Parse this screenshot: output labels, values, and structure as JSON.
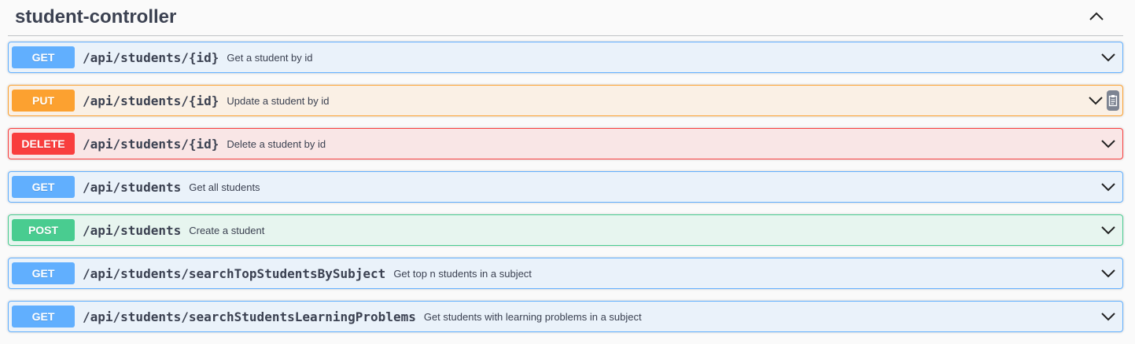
{
  "tag": {
    "title": "student-controller"
  },
  "operations": [
    {
      "method": "GET",
      "path": "/api/students/{id}",
      "summary": "Get a student by id"
    },
    {
      "method": "PUT",
      "path": "/api/students/{id}",
      "summary": "Update a student by id"
    },
    {
      "method": "DELETE",
      "path": "/api/students/{id}",
      "summary": "Delete a student by id"
    },
    {
      "method": "GET",
      "path": "/api/students",
      "summary": "Get all students"
    },
    {
      "method": "POST",
      "path": "/api/students",
      "summary": "Create a student"
    },
    {
      "method": "GET",
      "path": "/api/students/searchTopStudentsBySubject",
      "summary": "Get top n students in a subject"
    },
    {
      "method": "GET",
      "path": "/api/students/searchStudentsLearningProblems",
      "summary": "Get students with learning problems in a subject"
    }
  ],
  "icons": {
    "collapse": "chevron-up-icon",
    "expand": "chevron-down-icon",
    "copy": "copy-to-clipboard-icon"
  },
  "colors": {
    "get": "#61affe",
    "put": "#fca130",
    "delete": "#f93e3e",
    "post": "#49cc90",
    "text": "#3b4151"
  }
}
